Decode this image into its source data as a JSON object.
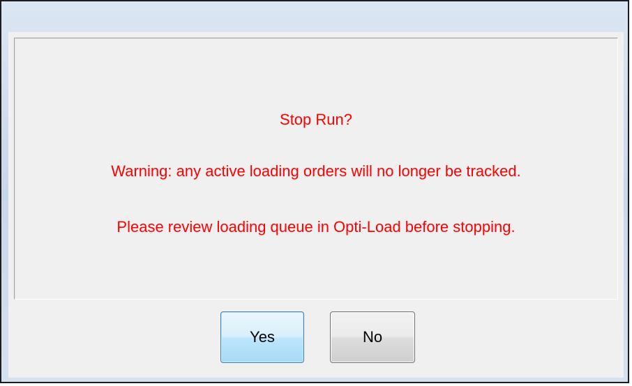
{
  "dialog": {
    "message_title": "Stop Run?",
    "message_warning": "Warning: any active loading orders will no longer be tracked.",
    "message_instruction": "Please review loading queue in Opti-Load before stopping.",
    "message_color": "#ff0000"
  },
  "buttons": {
    "yes_label": "Yes",
    "no_label": "No"
  }
}
